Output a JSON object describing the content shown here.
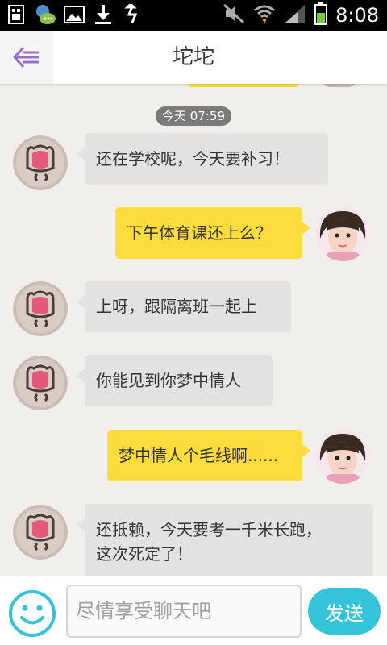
{
  "status_bar": {
    "time": "8:08",
    "left_icons": [
      "sim-icon",
      "chat-notification-icon",
      "image-icon",
      "download-icon",
      "usb-icon"
    ],
    "right_icons": [
      "mute-icon",
      "wifi-icon",
      "signal-icon",
      "battery-icon"
    ]
  },
  "header": {
    "title": "坨坨",
    "back_icon": "back-arrow-icon"
  },
  "timestamp": "今天 07:59",
  "messages": [
    {
      "side": "in",
      "text": "还在学校呢，今天要补习！"
    },
    {
      "side": "out",
      "text": "下午体育课还上么？"
    },
    {
      "side": "in",
      "text": "上呀，跟隔离班一起上"
    },
    {
      "side": "in",
      "text": "你能见到你梦中情人"
    },
    {
      "side": "out",
      "text": "梦中情人个毛线啊......"
    },
    {
      "side": "in",
      "text": "还抵赖，今天要考一千米长跑，这次死定了！"
    }
  ],
  "input_bar": {
    "emoji_icon": "smiley-icon",
    "placeholder": "尽情享受聊天吧",
    "value": "",
    "send_label": "发送"
  },
  "colors": {
    "incoming_bubble": "#e2e2e2",
    "outgoing_bubble": "#fddc3c",
    "send_button": "#34c3d8",
    "accent_back": "#9b6fd0"
  }
}
